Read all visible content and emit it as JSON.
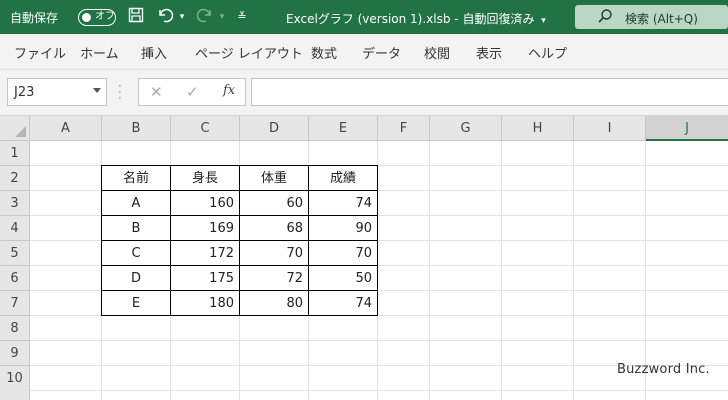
{
  "titlebar": {
    "autosave_label": "自動保存",
    "autosave_toggle": "オフ",
    "file_title": "Excelグラフ (version 1).xlsb  -  自動回復済み",
    "search_label": "検索 (Alt+Q)"
  },
  "ribbon": {
    "tabs": [
      "ファイル",
      "ホーム",
      "挿入",
      "ページ レイアウト",
      "数式",
      "データ",
      "校閲",
      "表示",
      "ヘルプ"
    ]
  },
  "formula_bar": {
    "name_box": "J23",
    "fx_label": "fx",
    "cancel_icon": "✕",
    "enter_icon": "✓",
    "content": ""
  },
  "grid": {
    "columns": [
      "A",
      "B",
      "C",
      "D",
      "E",
      "F",
      "G",
      "H",
      "I",
      "J"
    ],
    "selected_column": "J",
    "rows": [
      "1",
      "2",
      "3",
      "4",
      "5",
      "6",
      "7",
      "8",
      "9",
      "10"
    ]
  },
  "table": {
    "headers": [
      "名前",
      "身長",
      "体重",
      "成績"
    ],
    "rows": [
      [
        "A",
        "160",
        "60",
        "74"
      ],
      [
        "B",
        "169",
        "68",
        "90"
      ],
      [
        "C",
        "172",
        "70",
        "70"
      ],
      [
        "D",
        "175",
        "72",
        "50"
      ],
      [
        "E",
        "180",
        "80",
        "74"
      ]
    ]
  },
  "watermark": "Buzzword Inc.",
  "colors": {
    "brand_green": "#217346",
    "ribbon_bg": "#f3f3f3",
    "header_bg": "#e6e6e6"
  }
}
